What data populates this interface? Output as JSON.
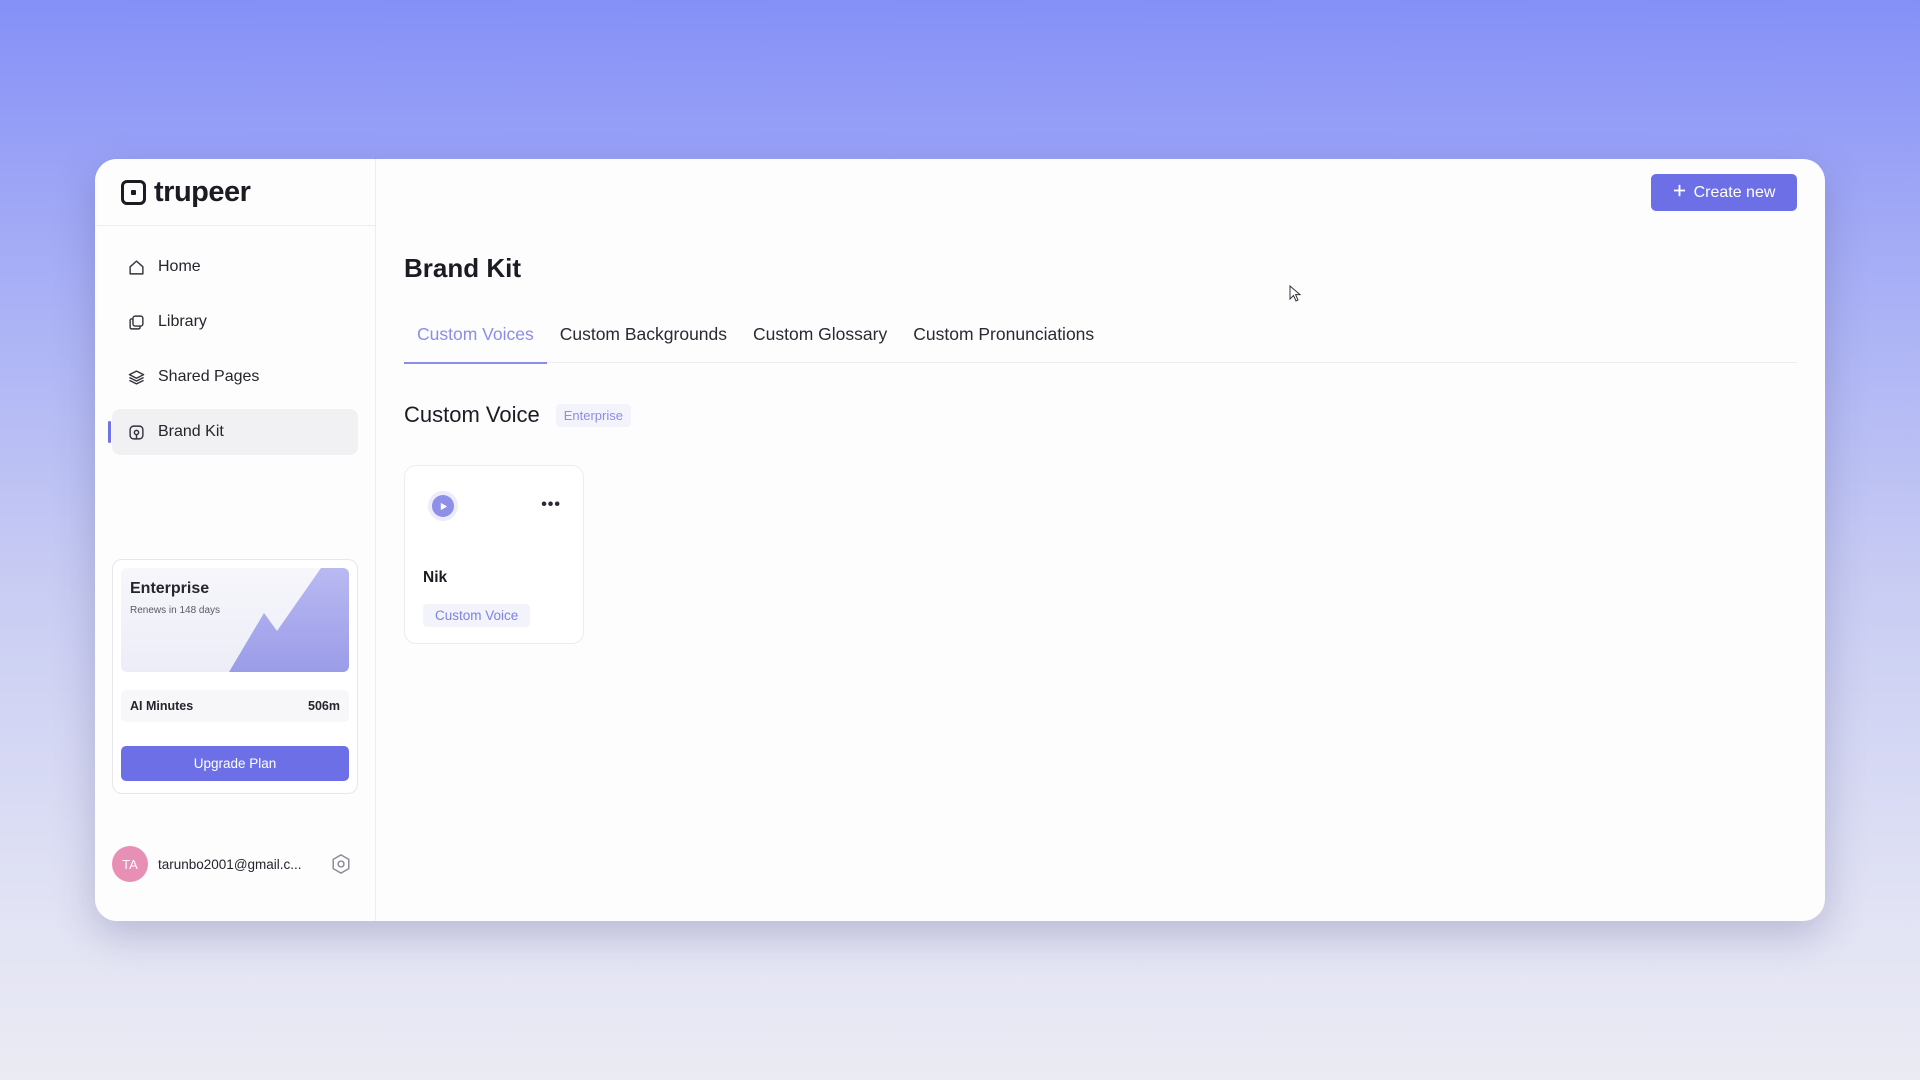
{
  "app": {
    "name": "trupeer"
  },
  "sidebar": {
    "items": [
      {
        "label": "Home",
        "icon": "home-icon",
        "active": false
      },
      {
        "label": "Library",
        "icon": "library-icon",
        "active": false
      },
      {
        "label": "Shared Pages",
        "icon": "layers-icon",
        "active": false
      },
      {
        "label": "Brand Kit",
        "icon": "brand-kit-icon",
        "active": true
      }
    ],
    "plan": {
      "name": "Enterprise",
      "renewal": "Renews in 148 days",
      "minutes_label": "AI Minutes",
      "minutes_value": "506m",
      "upgrade_label": "Upgrade Plan"
    },
    "user": {
      "initials": "TA",
      "email": "tarunbo2001@gmail.c..."
    }
  },
  "header": {
    "create_label": "Create new"
  },
  "main": {
    "title": "Brand Kit",
    "tabs": [
      {
        "label": "Custom Voices",
        "active": true
      },
      {
        "label": "Custom Backgrounds",
        "active": false
      },
      {
        "label": "Custom Glossary",
        "active": false
      },
      {
        "label": "Custom Pronunciations",
        "active": false
      }
    ],
    "section": {
      "title": "Custom Voice",
      "badge": "Enterprise"
    },
    "voices": [
      {
        "name": "Nik",
        "tag": "Custom Voice"
      }
    ]
  },
  "colors": {
    "accent": "#6c6fe6",
    "accent_light": "#8b8de8",
    "avatar": "#e78fb4"
  }
}
